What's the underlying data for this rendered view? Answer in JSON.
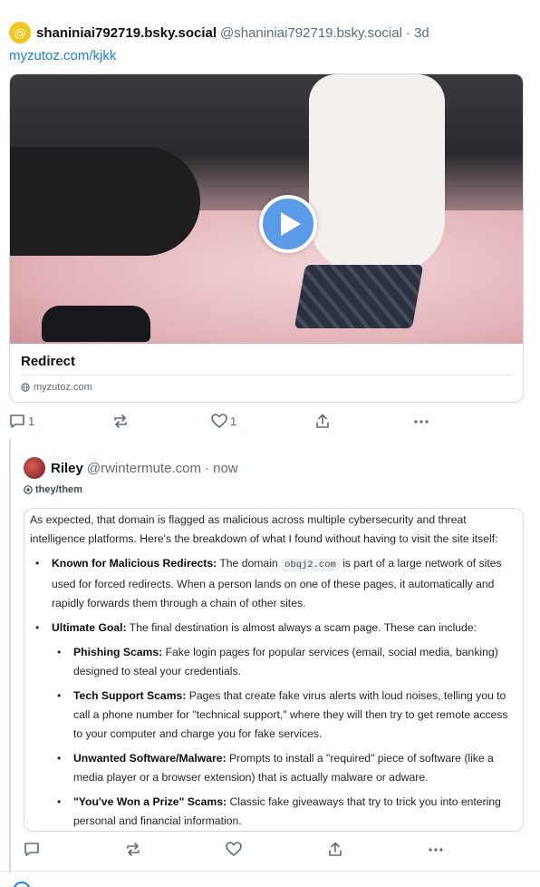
{
  "post": {
    "avatar_glyph": "@",
    "display_name": "shaniniai792719.bsky.social",
    "handle": "@shaniniai792719.bsky.social",
    "age": "· 3d",
    "link_text": "myzutoz.com/kjkk",
    "card": {
      "title": "Redirect",
      "domain": "myzutoz.com"
    },
    "actions": {
      "reply_count": "1",
      "repost_count": "",
      "like_count": "1"
    }
  },
  "reply": {
    "display_name": "Riley",
    "handle": "@rwintermute.com",
    "age": "· now",
    "pronouns": "they/them",
    "quote": {
      "intro": "As expected, that domain is flagged as malicious across multiple cybersecurity and threat intelligence platforms. Here's the breakdown of what I found without having to visit the site itself:",
      "b1_label": "Known for Malicious Redirects:",
      "b1_pre": " The domain ",
      "b1_code": "obqj2.com",
      "b1_post": " is part of a large network of sites used for forced redirects. When a person lands on one of these pages, it automatically and rapidly forwards them through a chain of other sites.",
      "b2_label": "Ultimate Goal:",
      "b2_text": " The final destination is almost always a scam page. These can include:",
      "s1_label": "Phishing Scams:",
      "s1_text": " Fake login pages for popular services (email, social media, banking) designed to steal your credentials.",
      "s2_label": "Tech Support Scams:",
      "s2_text": " Pages that create fake virus alerts with loud noises, telling you to call a phone number for \"technical support,\" where they will then try to get remote access to your computer and charge you for fake services.",
      "s3_label": "Unwanted Software/Malware:",
      "s3_text": " Prompts to install a \"required\" piece of software (like a media player or a browser extension) that is actually malware or adware.",
      "s4_label": "\"You've Won a Prize\" Scams:",
      "s4_text": " Classic fake giveaways that try to trick you into entering personal and financial information."
    }
  },
  "colors": {
    "link": "#1d7cf2",
    "muted": "#5b6b7c",
    "border": "#d4dbe2",
    "play_button": "#5a9ce8"
  },
  "icons": [
    "reply-icon",
    "repost-icon",
    "like-icon",
    "share-icon",
    "more-icon",
    "globe-icon",
    "play-icon"
  ]
}
